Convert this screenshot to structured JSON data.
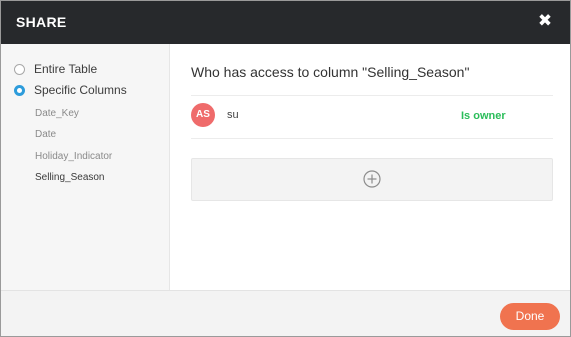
{
  "dialog": {
    "title": "SHARE",
    "close_icon": "close-icon"
  },
  "sidebar": {
    "options": [
      {
        "label": "Entire Table",
        "checked": false
      },
      {
        "label": "Specific Columns",
        "checked": true
      }
    ],
    "columns": [
      {
        "label": "Date_Key",
        "selected": false
      },
      {
        "label": "Date",
        "selected": false
      },
      {
        "label": "Holiday_Indicator",
        "selected": false
      },
      {
        "label": "Selling_Season",
        "selected": true
      }
    ]
  },
  "main": {
    "heading": "Who has access to column \"Selling_Season\"",
    "users": [
      {
        "initials": "AS",
        "name": "su",
        "role": "Is owner",
        "avatar_color": "#ef6b6b"
      }
    ],
    "add_icon": "plus-circle-icon"
  },
  "footer": {
    "done_label": "Done"
  },
  "colors": {
    "titlebar": "#27292c",
    "accent": "#2d9cdb",
    "owner": "#2bbd5a",
    "done_button": "#f0734f"
  }
}
